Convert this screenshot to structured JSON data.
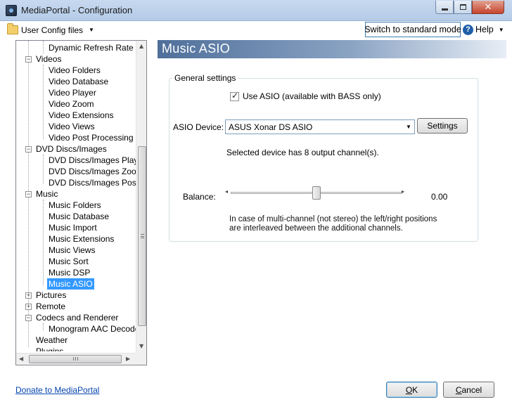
{
  "window": {
    "title": "MediaPortal - Configuration"
  },
  "toolbar": {
    "config_files_label": "User Config files",
    "switch_mode_label": "Switch to standard mode",
    "help_label": "Help"
  },
  "tree": {
    "items": [
      {
        "label": "Dynamic Refresh Rate"
      },
      {
        "label": "Videos"
      },
      {
        "label": "Video Folders"
      },
      {
        "label": "Video Database"
      },
      {
        "label": "Video Player"
      },
      {
        "label": "Video Zoom"
      },
      {
        "label": "Video Extensions"
      },
      {
        "label": "Video Views"
      },
      {
        "label": "Video Post Processing"
      },
      {
        "label": "DVD Discs/Images"
      },
      {
        "label": "DVD Discs/Images Player"
      },
      {
        "label": "DVD Discs/Images Zoom"
      },
      {
        "label": "DVD Discs/Images Post Processing"
      },
      {
        "label": "Music"
      },
      {
        "label": "Music Folders"
      },
      {
        "label": "Music Database"
      },
      {
        "label": "Music Import"
      },
      {
        "label": "Music Extensions"
      },
      {
        "label": "Music Views"
      },
      {
        "label": "Music Sort"
      },
      {
        "label": "Music DSP"
      },
      {
        "label": "Music ASIO"
      },
      {
        "label": "Pictures"
      },
      {
        "label": "Remote"
      },
      {
        "label": "Codecs and Renderer"
      },
      {
        "label": "Monogram AAC Decoder"
      },
      {
        "label": "Weather"
      },
      {
        "label": "Plugins"
      }
    ]
  },
  "section": {
    "title": "Music ASIO",
    "group_label": "General settings",
    "use_asio_label": "Use ASIO (available with BASS only)",
    "use_asio_checked": true,
    "device_label": "ASIO Device:",
    "device_value": "ASUS Xonar DS ASIO",
    "settings_label": "Settings",
    "channels_text": "Selected device has 8 output channel(s).",
    "balance_label": "Balance:",
    "balance_value": "0.00",
    "balance_fraction": 0.5,
    "note_line1": "In case of multi-channel (not stereo) the left/right positions",
    "note_line2": "are interleaved between the additional channels."
  },
  "footer": {
    "donate_label": "Donate to MediaPortal",
    "ok_label": "OK",
    "cancel_label": "Cancel"
  },
  "icons": {
    "app": "mediaportal-app-icon",
    "config_files": "folder-icon",
    "help": "help-icon"
  }
}
